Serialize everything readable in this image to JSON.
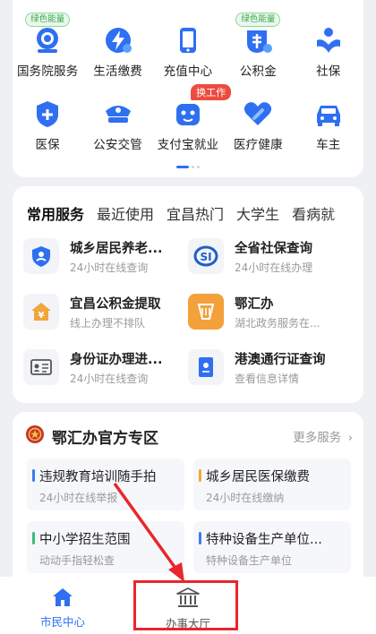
{
  "grid": {
    "items": [
      {
        "label": "国务院服务",
        "icon": "state-council-icon",
        "badge": "绿色能量"
      },
      {
        "label": "生活缴费",
        "icon": "bolt-icon"
      },
      {
        "label": "充值中心",
        "icon": "phone-icon"
      },
      {
        "label": "公积金",
        "icon": "housing-fund-icon",
        "badge": "绿色能量"
      },
      {
        "label": "社保",
        "icon": "social-security-icon"
      },
      {
        "label": "医保",
        "icon": "medical-insurance-icon"
      },
      {
        "label": "公安交管",
        "icon": "police-cap-icon"
      },
      {
        "label": "支付宝就业",
        "icon": "robot-icon",
        "badge_red": "换工作"
      },
      {
        "label": "医疗健康",
        "icon": "heart-icon"
      },
      {
        "label": "车主",
        "icon": "car-icon"
      }
    ]
  },
  "services": {
    "tabs": [
      "常用服务",
      "最近使用",
      "宜昌热门",
      "大学生",
      "看病就"
    ],
    "items": [
      {
        "title": "城乡居民养老...",
        "sub": "24小时在线查询"
      },
      {
        "title": "全省社保查询",
        "sub": "24小时在线办理"
      },
      {
        "title": "宜昌公积金提取",
        "sub": "线上办理不排队"
      },
      {
        "title": "鄂汇办",
        "sub": "湖北政务服务在..."
      },
      {
        "title": "身份证办理进...",
        "sub": "24小时在线查询"
      },
      {
        "title": "港澳通行证查询",
        "sub": "查看信息详情"
      }
    ]
  },
  "zone": {
    "title": "鄂汇办官方专区",
    "more": "更多服务",
    "items": [
      {
        "title": "违规教育培训随手拍",
        "sub": "24小时在线举报"
      },
      {
        "title": "城乡居民医保缴费",
        "sub": "24小时在线缴纳"
      },
      {
        "title": "中小学招生范围",
        "sub": "动动手指轻松查"
      },
      {
        "title": "特种设备生产单位...",
        "sub": "特种设备生产单位"
      }
    ]
  },
  "nav": {
    "home": "市民中心",
    "hall": "办事大厅"
  },
  "colors": {
    "accent": "#2f6ff1",
    "highlight": "#e8262b"
  }
}
